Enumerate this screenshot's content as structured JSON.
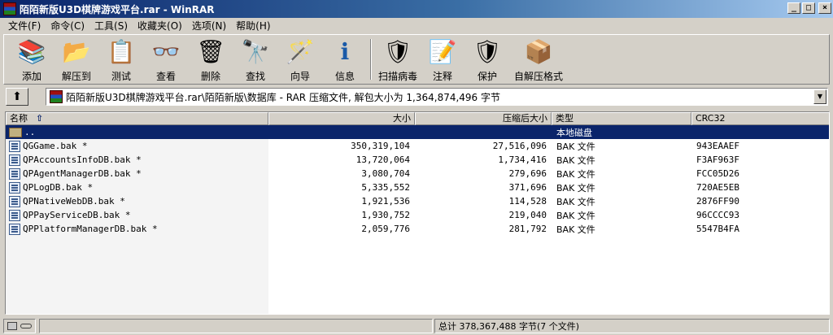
{
  "window": {
    "title": "陌陌新版U3D棋牌游戏平台.rar - WinRAR",
    "min": "_",
    "max": "□",
    "close": "×"
  },
  "menu": [
    "文件(F)",
    "命令(C)",
    "工具(S)",
    "收藏夹(O)",
    "选项(N)",
    "帮助(H)"
  ],
  "toolbar": [
    {
      "label": "添加",
      "icon": "add-icon",
      "glyph": "📚",
      "color": "#8b1a1a"
    },
    {
      "label": "解压到",
      "icon": "extract-to-icon",
      "glyph": "📂",
      "color": "#b8860b"
    },
    {
      "label": "测试",
      "icon": "test-icon",
      "glyph": "📋",
      "color": "#1a3a8b"
    },
    {
      "label": "查看",
      "icon": "view-icon",
      "glyph": "👓",
      "color": "#555555"
    },
    {
      "label": "删除",
      "icon": "delete-icon",
      "glyph": "🗑",
      "color": "#6a3a8b"
    },
    {
      "label": "查找",
      "icon": "find-icon",
      "glyph": "🔭",
      "color": "#333333"
    },
    {
      "label": "向导",
      "icon": "wizard-icon",
      "glyph": "🪄",
      "color": "#aa2266"
    },
    {
      "label": "信息",
      "icon": "info-icon",
      "glyph": "ℹ",
      "color": "#1a5aa8"
    },
    {
      "label": "扫描病毒",
      "icon": "virus-scan-icon",
      "glyph": "🛡",
      "color": "#b8860b"
    },
    {
      "label": "注释",
      "icon": "comment-icon",
      "glyph": "📝",
      "color": "#444444"
    },
    {
      "label": "保护",
      "icon": "protect-icon",
      "glyph": "🛡",
      "color": "#555555"
    },
    {
      "label": "自解压格式",
      "icon": "sfx-icon",
      "glyph": "📦",
      "color": "#4a7a1a"
    }
  ],
  "path": "陌陌新版U3D棋牌游戏平台.rar\\陌陌新版\\数据库 - RAR 压缩文件, 解包大小为 1,364,874,496 字节",
  "columns": {
    "name": "名称",
    "size": "大小",
    "packed": "压缩后大小",
    "type": "类型",
    "crc": "CRC32"
  },
  "rows": [
    {
      "name": "..",
      "size": "",
      "packed": "",
      "type": "本地磁盘",
      "crc": "",
      "folder": true,
      "selected": true
    },
    {
      "name": "QGGame.bak *",
      "size": "350,319,104",
      "packed": "27,516,096",
      "type": "BAK 文件",
      "crc": "943EAAEF"
    },
    {
      "name": "QPAccountsInfoDB.bak *",
      "size": "13,720,064",
      "packed": "1,734,416",
      "type": "BAK 文件",
      "crc": "F3AF963F"
    },
    {
      "name": "QPAgentManagerDB.bak *",
      "size": "3,080,704",
      "packed": "279,696",
      "type": "BAK 文件",
      "crc": "FCC05D26"
    },
    {
      "name": "QPLogDB.bak *",
      "size": "5,335,552",
      "packed": "371,696",
      "type": "BAK 文件",
      "crc": "720AE5EB"
    },
    {
      "name": "QPNativeWebDB.bak *",
      "size": "1,921,536",
      "packed": "114,528",
      "type": "BAK 文件",
      "crc": "2876FF90"
    },
    {
      "name": "QPPayServiceDB.bak *",
      "size": "1,930,752",
      "packed": "219,040",
      "type": "BAK 文件",
      "crc": "96CCCC93"
    },
    {
      "name": "QPPlatformManagerDB.bak *",
      "size": "2,059,776",
      "packed": "281,792",
      "type": "BAK 文件",
      "crc": "5547B4FA"
    }
  ],
  "status": {
    "total": "总计 378,367,488 字节(7 个文件)"
  }
}
